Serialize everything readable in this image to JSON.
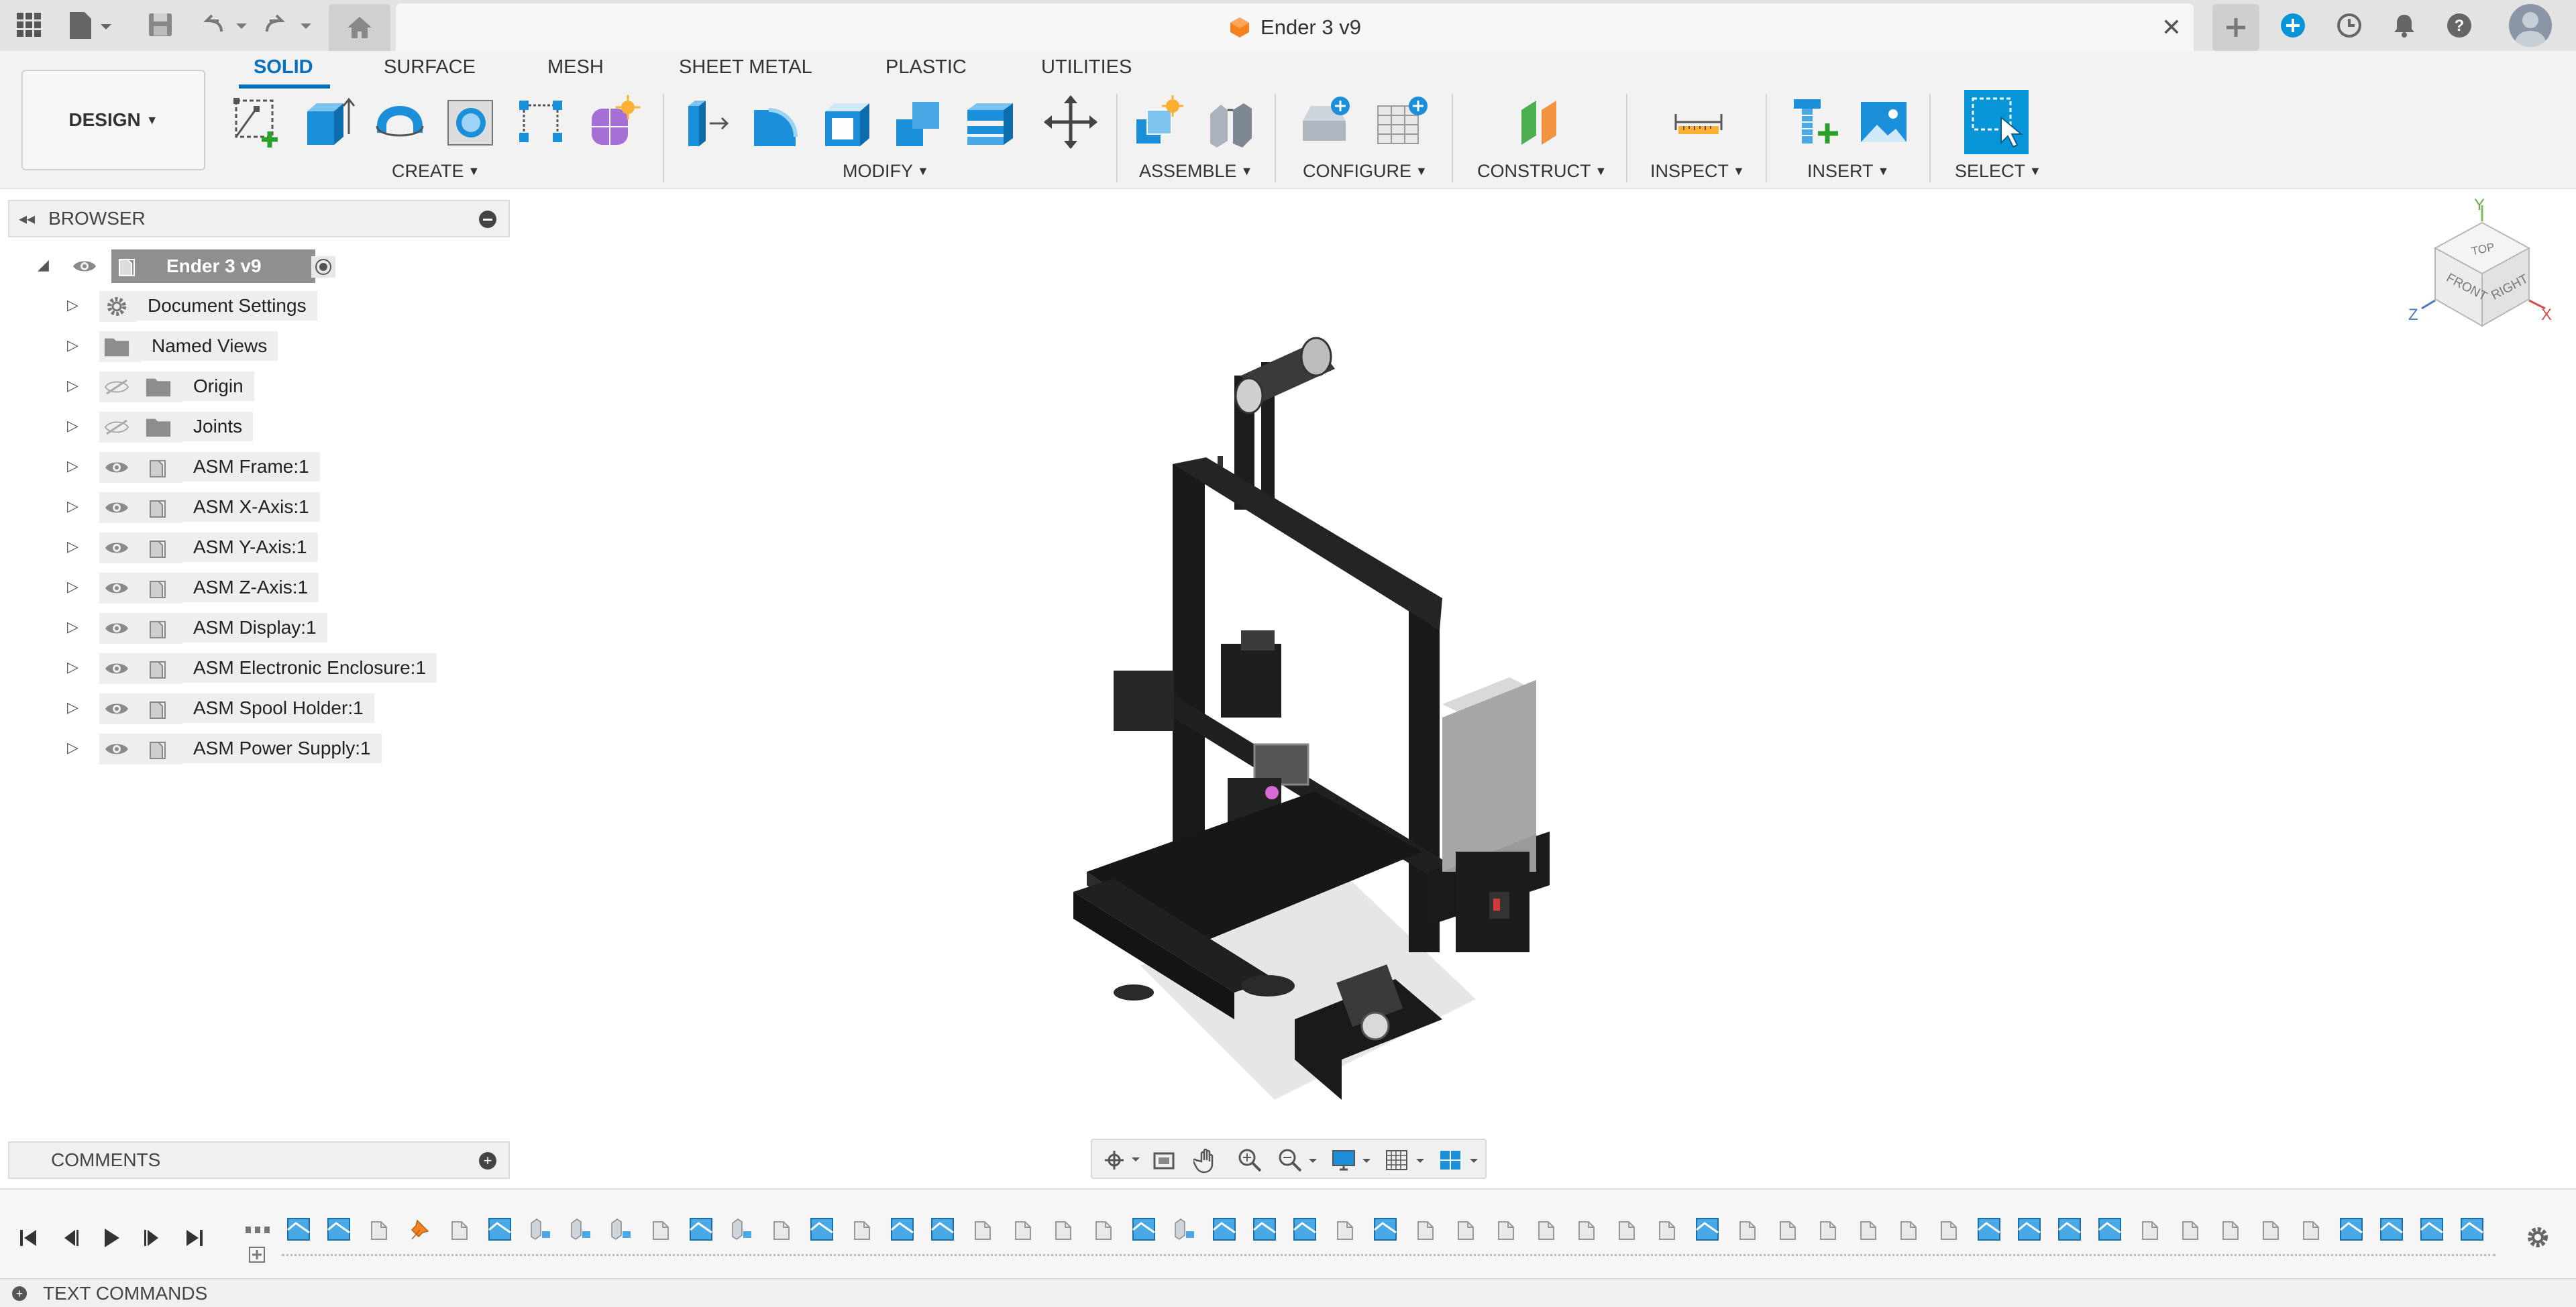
{
  "document": {
    "title": "Ender 3 v9"
  },
  "workspace": {
    "label": "DESIGN"
  },
  "tabs": [
    {
      "label": "SOLID",
      "active": true
    },
    {
      "label": "SURFACE"
    },
    {
      "label": "MESH"
    },
    {
      "label": "SHEET METAL"
    },
    {
      "label": "PLASTIC"
    },
    {
      "label": "UTILITIES"
    }
  ],
  "groups": {
    "create": "CREATE",
    "modify": "MODIFY",
    "assemble": "ASSEMBLE",
    "configure": "CONFIGURE",
    "construct": "CONSTRUCT",
    "inspect": "INSPECT",
    "insert": "INSERT",
    "select": "SELECT"
  },
  "browser": {
    "title": "BROWSER",
    "root": "Ender 3 v9",
    "items": [
      {
        "label": "Document Settings",
        "icon": "gear-icon"
      },
      {
        "label": "Named Views",
        "icon": "folder-icon"
      },
      {
        "label": "Origin",
        "icon": "folder-icon",
        "hidden": true
      },
      {
        "label": "Joints",
        "icon": "folder-icon",
        "hidden": true
      },
      {
        "label": "ASM Frame:1",
        "icon": "component-icon"
      },
      {
        "label": "ASM X-Axis:1",
        "icon": "component-icon"
      },
      {
        "label": "ASM Y-Axis:1",
        "icon": "component-icon"
      },
      {
        "label": "ASM Z-Axis:1",
        "icon": "component-icon"
      },
      {
        "label": "ASM Display:1",
        "icon": "component-icon"
      },
      {
        "label": "ASM Electronic Enclosure:1",
        "icon": "component-icon"
      },
      {
        "label": "ASM Spool Holder:1",
        "icon": "component-icon"
      },
      {
        "label": "ASM Power Supply:1",
        "icon": "component-icon"
      }
    ]
  },
  "comments": {
    "title": "COMMENTS"
  },
  "textcommands": {
    "title": "TEXT COMMANDS"
  },
  "viewcube": {
    "top": "TOP",
    "front": "FRONT",
    "right": "RIGHT",
    "axis_x": "X",
    "axis_y": "Y",
    "axis_z": "Z"
  },
  "colors": {
    "accent": "#0696d7",
    "active_tab": "#0670bf",
    "orange": "#f58220"
  }
}
